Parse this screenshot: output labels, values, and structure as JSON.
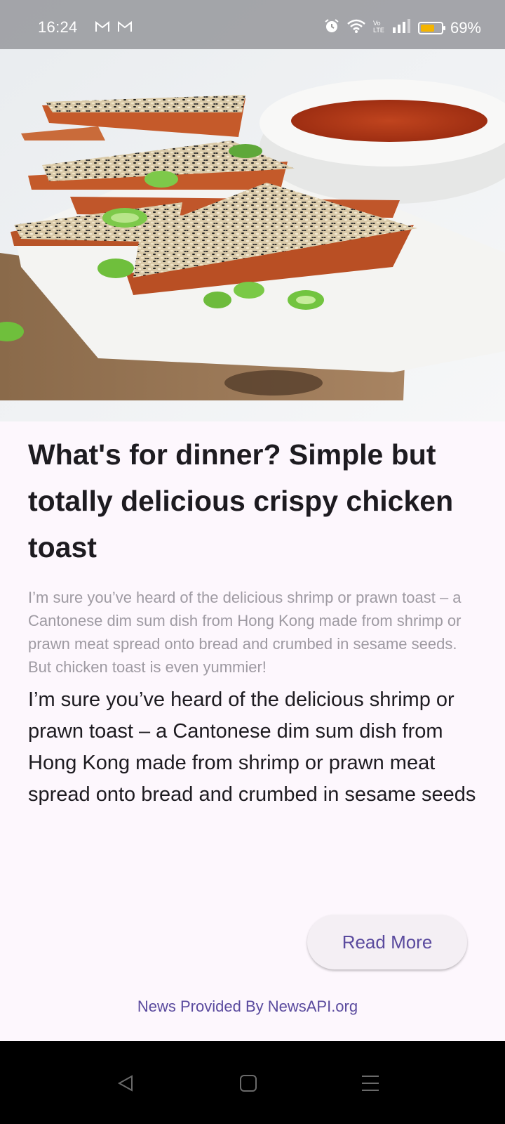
{
  "status_bar": {
    "time": "16:24",
    "notification_icons": [
      "gmail-icon",
      "gmail-icon"
    ],
    "right_icons": [
      "alarm-icon",
      "wifi-icon",
      "volte-icon",
      "signal-icon"
    ],
    "battery_percent": "69%",
    "battery_level": 0.69,
    "battery_color": "#f4b400"
  },
  "article": {
    "image_description_icon": "food-photo",
    "title": "What's for dinner? Simple but totally delicious crispy chicken toast",
    "description": "I’m sure you’ve heard of the delicious shrimp or prawn toast – a Cantonese dim sum dish from Hong Kong made from shrimp or prawn meat spread onto bread and crumbed in sesame seeds. But chicken toast is even yummier!",
    "content": "I’m sure you’ve heard of the delicious shrimp or prawn toast – a Cantonese dim sum dish from Hong Kong made from shrimp or prawn meat spread onto bread and crumbed in sesame seeds",
    "read_more_label": "Read More",
    "provider": "News Provided By NewsAPI.org"
  },
  "nav_bar": {
    "buttons": [
      "back-icon",
      "home-icon",
      "recents-icon"
    ]
  },
  "colors": {
    "background": "#fdf7fd",
    "accent": "#5a4a9e",
    "title": "#1d1b20",
    "description": "#9e9aa2"
  }
}
